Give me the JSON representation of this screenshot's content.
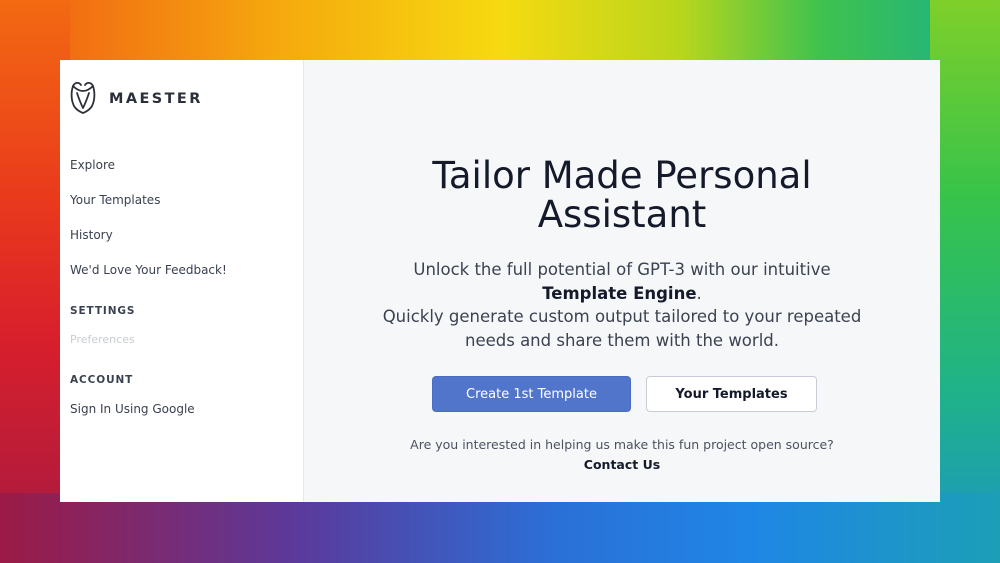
{
  "app": {
    "name": "MAESTER",
    "logo_icon": "maester-logo-icon"
  },
  "sidebar": {
    "nav": [
      {
        "label": "Explore"
      },
      {
        "label": "Your Templates"
      },
      {
        "label": "History"
      },
      {
        "label": "We'd Love Your Feedback!"
      }
    ],
    "settings": {
      "heading": "SETTINGS",
      "items": [
        {
          "label": "Preferences",
          "disabled": true
        }
      ]
    },
    "account": {
      "heading": "ACCOUNT",
      "items": [
        {
          "label": "Sign In Using Google"
        }
      ]
    }
  },
  "main": {
    "headline_line1": "Tailor Made Personal",
    "headline_line2": "Assistant",
    "desc_line1": "Unlock the full potential of GPT-3 with our intuitive",
    "desc_bold": "Template Engine",
    "desc_period": ".",
    "desc_line3": "Quickly generate custom output tailored to your repeated",
    "desc_line4": "needs and share them with the world.",
    "primary_button": "Create 1st Template",
    "secondary_button": "Your Templates",
    "question": "Are you interested in helping us make this fun project open source?",
    "contact_link": "Contact Us"
  },
  "colors": {
    "primary": "#5275cc",
    "sidebar_bg": "#ffffff",
    "main_bg": "#f6f7f9",
    "text_dark": "#141a2a"
  }
}
